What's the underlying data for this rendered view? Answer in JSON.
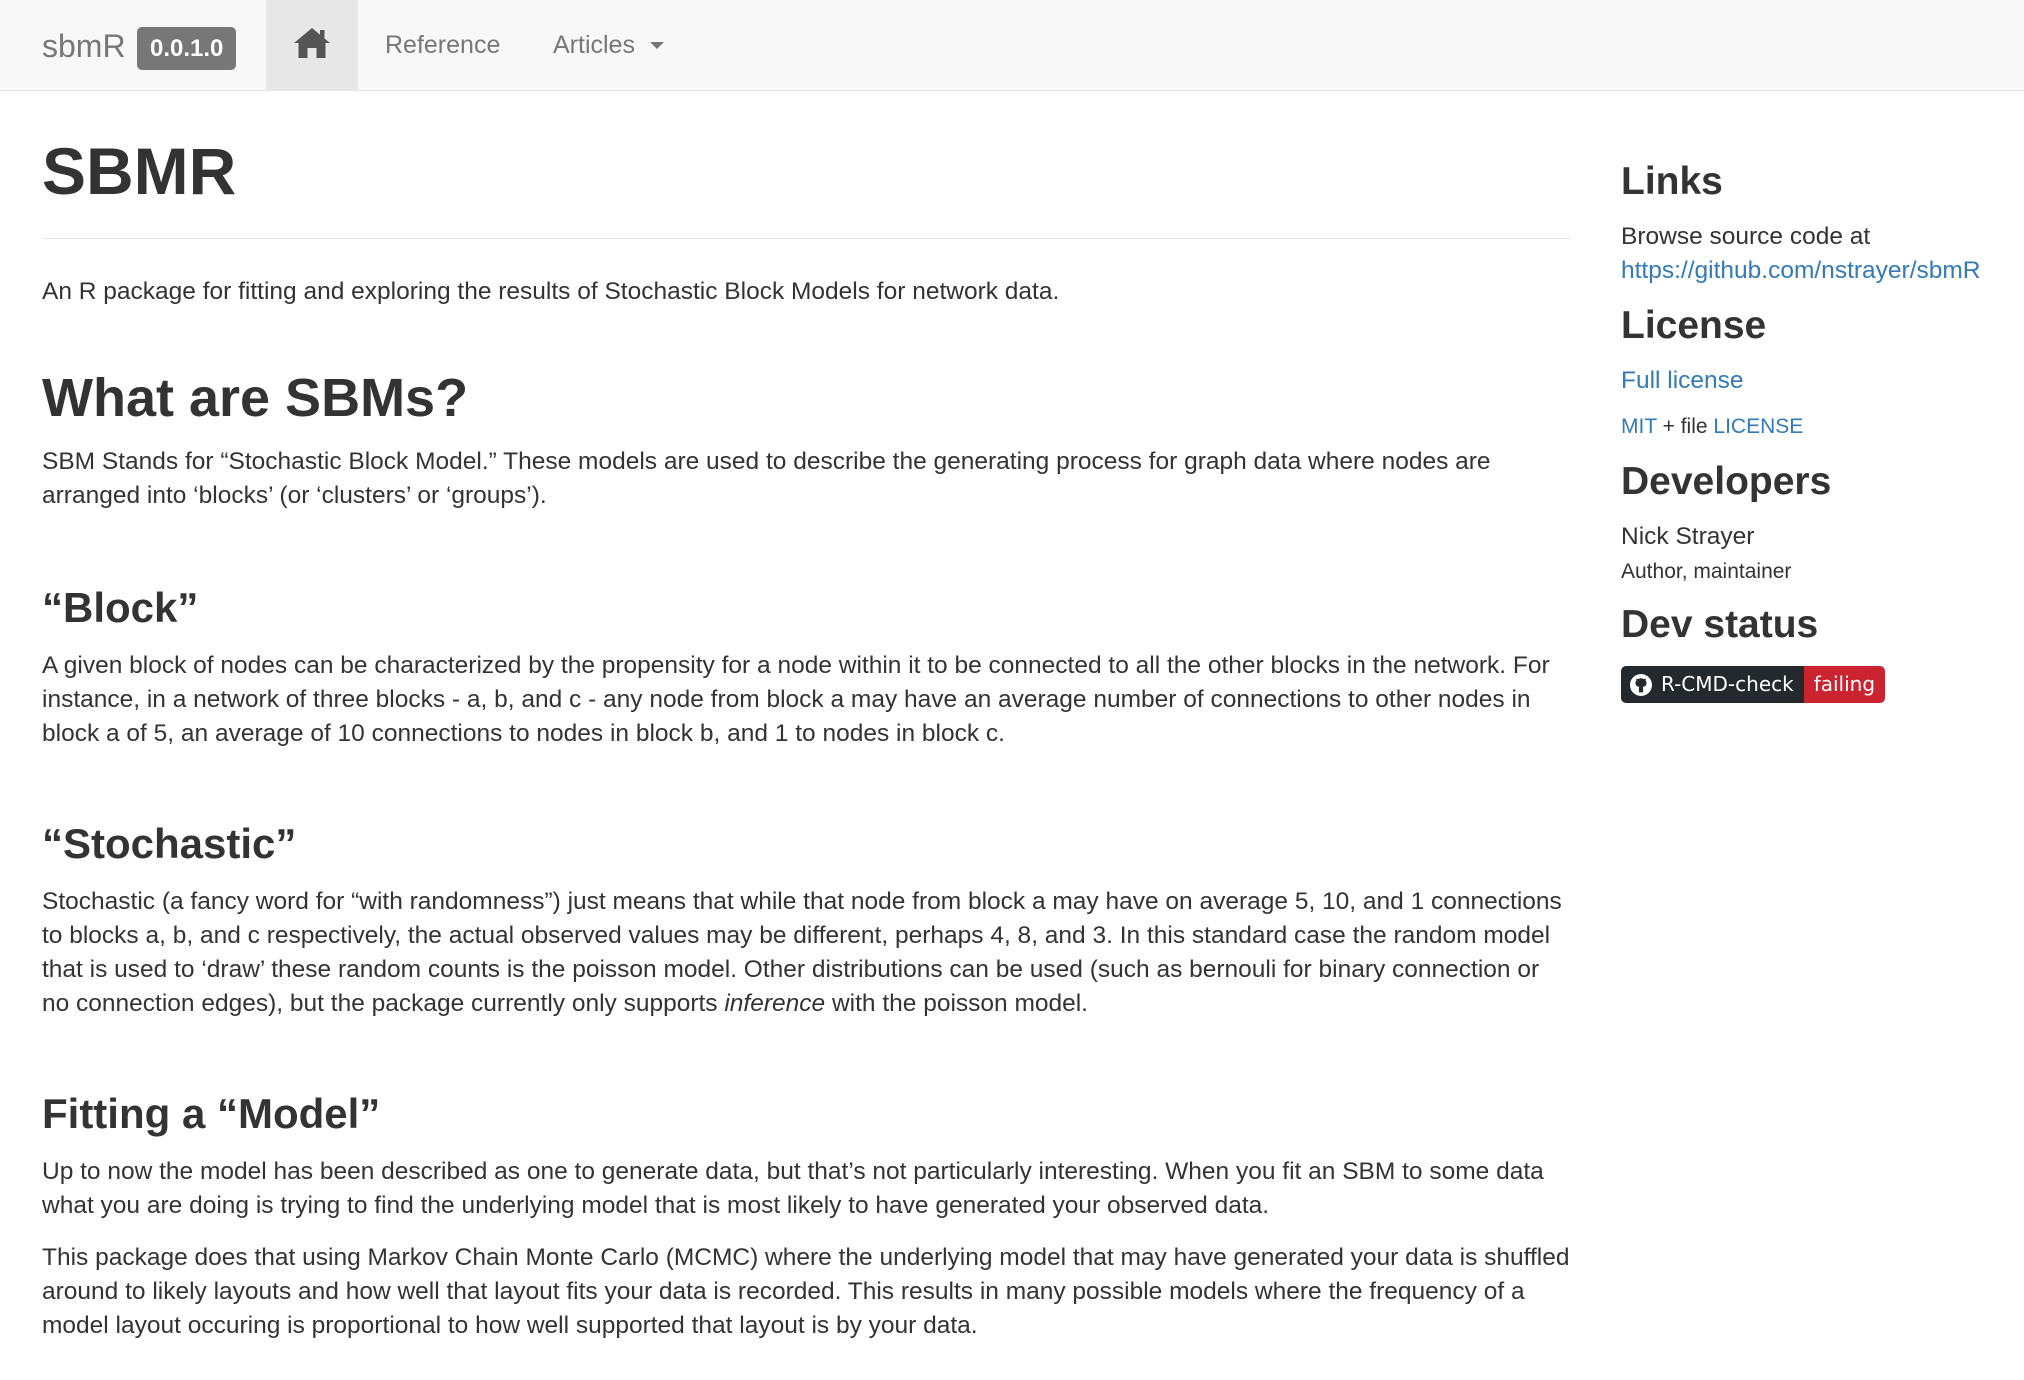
{
  "navbar": {
    "brand": "sbmR",
    "version": "0.0.1.0",
    "home_icon": "home-icon",
    "links": {
      "reference": "Reference",
      "articles": "Articles"
    }
  },
  "main": {
    "title": "SBMR",
    "intro": "An R package for fitting and exploring the results of Stochastic Block Models for network data.",
    "sections": {
      "what": {
        "heading": "What are SBMs?",
        "body": "SBM Stands for “Stochastic Block Model.” These models are used to describe the generating process for graph data where nodes are arranged into ‘blocks’ (or ‘clusters’ or ‘groups’)."
      },
      "block": {
        "heading": "“Block”",
        "body": "A given block of nodes can be characterized by the propensity for a node within it to be connected to all the other blocks in the network. For instance, in a network of three blocks - a, b, and c - any node from block a may have an average number of connections to other nodes in block a of 5, an average of 10 connections to nodes in block b, and 1 to nodes in block c."
      },
      "stochastic": {
        "heading": "“Stochastic”",
        "body_before": "Stochastic (a fancy word for “with randomness”) just means that while that node from block a may have on average 5, 10, and 1 connections to blocks a, b, and c respectively, the actual observed values may be different, perhaps 4, 8, and 3. In this standard case the random model that is used to ‘draw’ these random counts is the poisson model. Other distributions can be used (such as bernouli for binary connection or no connection edges), but the package currently only supports ",
        "body_emphasis": "inference",
        "body_after": " with the poisson model."
      },
      "fitting": {
        "heading": "Fitting a “Model”",
        "body1": "Up to now the model has been described as one to generate data, but that’s not particularly interesting. When you fit an SBM to some data what you are doing is trying to find the underlying model that is most likely to have generated your observed data.",
        "body2": "This package does that using Markov Chain Monte Carlo (MCMC) where the underlying model that may have generated your data is shuffled around to likely layouts and how well that layout fits your data is recorded. This results in many possible models where the frequency of a model layout occuring is proportional to how well supported that layout is by your data."
      }
    }
  },
  "sidebar": {
    "links": {
      "heading": "Links",
      "browse_text": "Browse source code at",
      "source_url": "https://github.com/nstrayer/sbmR"
    },
    "license": {
      "heading": "License",
      "full_license": "Full license",
      "mit": "MIT",
      "plus_file": " + file ",
      "license_file": "LICENSE"
    },
    "developers": {
      "heading": "Developers",
      "name": "Nick Strayer",
      "role": "Author, maintainer"
    },
    "dev_status": {
      "heading": "Dev status",
      "badge_icon": "github-icon",
      "badge_label": "R-CMD-check",
      "badge_status": "failing"
    }
  },
  "colors": {
    "link": "#337ab7",
    "navbar_bg": "#f8f8f8",
    "badge_dark": "#24292e",
    "badge_fail": "#cb2431"
  }
}
